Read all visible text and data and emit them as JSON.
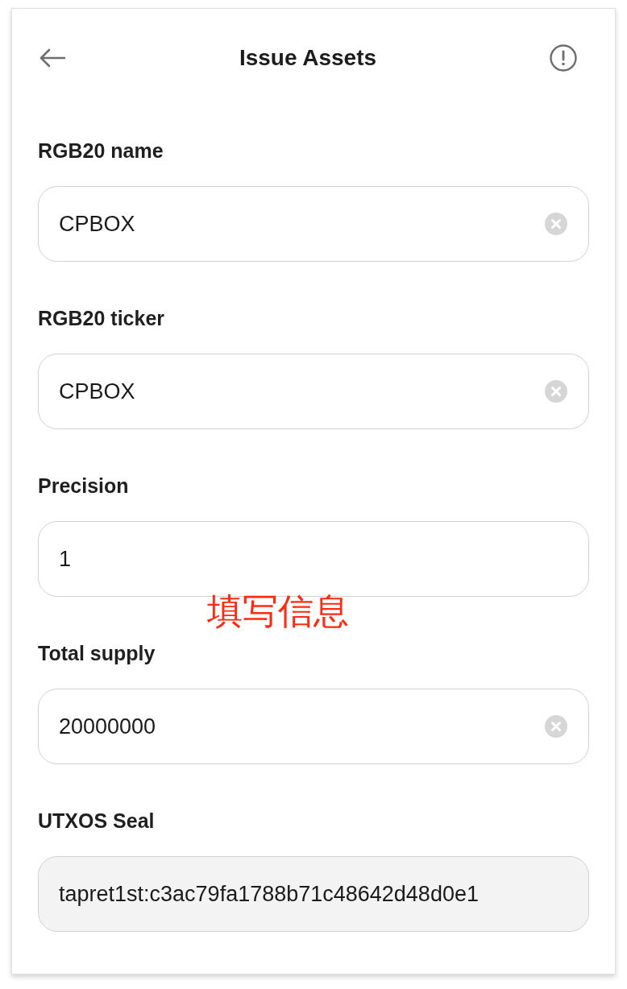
{
  "header": {
    "title": "Issue Assets"
  },
  "fields": [
    {
      "label": "RGB20 name",
      "value": "CPBOX",
      "kind": "clearable"
    },
    {
      "label": "RGB20 ticker",
      "value": "CPBOX",
      "kind": "clearable"
    },
    {
      "label": "Precision",
      "value": "1",
      "kind": "plain"
    },
    {
      "label": "Total supply",
      "value": "20000000",
      "kind": "clearable"
    },
    {
      "label": "UTXOS Seal",
      "value": "tapret1st:c3ac79fa1788b71c48642d48d0e1",
      "kind": "readonly"
    }
  ],
  "annotation": {
    "text": "填写信息"
  }
}
